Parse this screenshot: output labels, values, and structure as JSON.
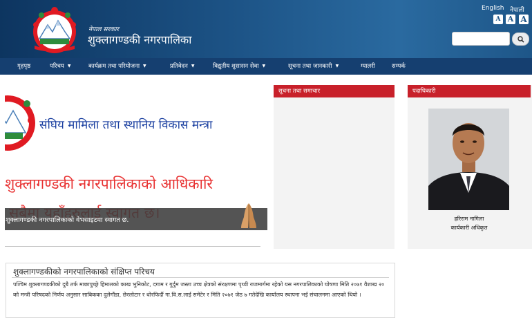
{
  "header": {
    "gov_small": "नेपाल सरकार",
    "title": "शुक्लागण्डकी नगरपालिका",
    "lang_english": "English",
    "lang_nepali": "नेपाली",
    "font_small": "A",
    "font_medium": "A",
    "font_large": "A",
    "search_value": "",
    "search_icon": "search-icon",
    "logo": "nepal-emblem"
  },
  "nav": {
    "items": [
      {
        "label": "गृहपृष्ठ"
      },
      {
        "label": "परिचय"
      },
      {
        "label": "कार्यक्रम तथा परियोजना"
      },
      {
        "label": "प्रतिवेदन"
      },
      {
        "label": "विद्युतीय शुसासन सेवा"
      },
      {
        "label": "सूचना तथा जानकारी"
      },
      {
        "label": "ग्यालरी"
      },
      {
        "label": "सम्पर्क"
      }
    ]
  },
  "slider": {
    "banner_line1": "संघिय मामिला तथा स्थानिय विकास मन्त्रा",
    "banner_line2": "शुक्लागण्डकी नगरपालिकाको आधिकारि",
    "banner_line3": "सबैमा यहाँहरुलाई स्वागत छ।",
    "caption": "शुक्लागण्डकी नगरपालिकाको वेभसाइटमा स्वागत छ.",
    "caption_icon": "namaste-hands-icon"
  },
  "news": {
    "heading": "सूचना तथा समाचार"
  },
  "officials": {
    "heading": "पदाधिकारी",
    "name": "हरिराम नागिला",
    "role": "कार्यकारी अधिकृत"
  },
  "intro": {
    "title": "शुक्लागण्डकीको नगरपालिकाको संक्षिप्त परिचय",
    "body": "पश्चिम शुक्लागण्डकीको दुबै तर्फ माछापुच्छ्रे हिमालको काख भुनिकोट, दगाम र गुर्दुम जस्ता उच्च क्षेत्रको संरक्षणमा पृथ्वी राजमार्गमा रहेको यस नगरपालिकाको घोषणा मिति २०७१ वैशाख २० को मन्त्री परिषदको निर्णय अनुसार साबिकका दुलेगौंडा, छेरलोटार र धोरफिर्दी गा.वि.स.लाई समेटेर र मिति २०७१ जेठ ७ गतेदेखि कार्यालय स्थापना भई संचालनमा आएको थियो ।"
  },
  "colors": {
    "header_bg": "#1d5487",
    "nav_bg": "#153f70",
    "panel_head_red": "#c8202a",
    "panel_bg": "#f3f3f3"
  }
}
